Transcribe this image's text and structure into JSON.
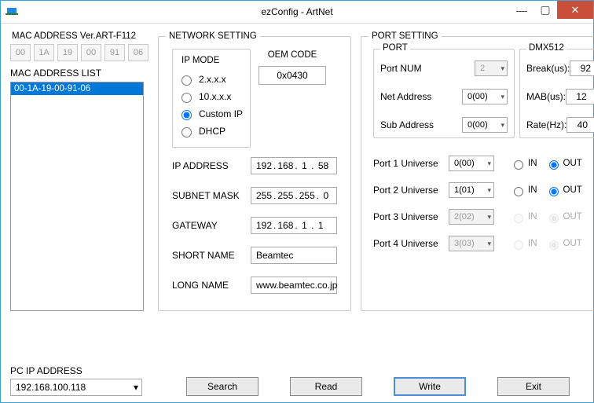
{
  "window": {
    "title": "ezConfig - ArtNet"
  },
  "mac": {
    "version_label": "MAC ADDRESS  Ver.ART-F112",
    "bytes": [
      "00",
      "1A",
      "19",
      "00",
      "91",
      "06"
    ],
    "list_label": "MAC ADDRESS LIST",
    "list": [
      "00-1A-19-00-91-06"
    ]
  },
  "network": {
    "legend": "NETWORK SETTING",
    "ipmode": {
      "label": "IP MODE",
      "options": {
        "opt2": "2.x.x.x",
        "opt10": "10.x.x.x",
        "custom": "Custom IP",
        "dhcp": "DHCP"
      },
      "selected": "custom"
    },
    "oem": {
      "label": "OEM CODE",
      "value": "0x0430"
    },
    "fields": {
      "ip": {
        "label": "IP ADDRESS",
        "a": "192",
        "b": "168",
        "c": "1",
        "d": "58"
      },
      "subnet": {
        "label": "SUBNET MASK",
        "a": "255",
        "b": "255",
        "c": "255",
        "d": "0"
      },
      "gateway": {
        "label": "GATEWAY",
        "a": "192",
        "b": "168",
        "c": "1",
        "d": "1"
      },
      "shortname": {
        "label": "SHORT NAME",
        "value": "Beamtec"
      },
      "longname": {
        "label": "LONG NAME",
        "value": "www.beamtec.co.jp"
      }
    }
  },
  "port": {
    "legend": "PORT SETTING",
    "port_group": {
      "label": "PORT",
      "port_num": {
        "label": "Port NUM",
        "value": "2"
      },
      "net_addr": {
        "label": "Net Address",
        "value": "0(00)"
      },
      "sub_addr": {
        "label": "Sub Address",
        "value": "0(00)"
      }
    },
    "dmx": {
      "label": "DMX512",
      "break": {
        "label": "Break(us):",
        "value": "92"
      },
      "mab": {
        "label": "MAB(us):",
        "value": "12"
      },
      "rate": {
        "label": "Rate(Hz):",
        "value": "40"
      }
    },
    "universes": [
      {
        "label": "Port 1 Universe",
        "value": "0(00)",
        "in": false,
        "out": true,
        "enabled": true
      },
      {
        "label": "Port 2 Universe",
        "value": "1(01)",
        "in": false,
        "out": true,
        "enabled": true
      },
      {
        "label": "Port 3 Universe",
        "value": "2(02)",
        "in": false,
        "out": true,
        "enabled": false
      },
      {
        "label": "Port 4 Universe",
        "value": "3(03)",
        "in": false,
        "out": true,
        "enabled": false
      }
    ],
    "io_labels": {
      "in": "IN",
      "out": "OUT"
    }
  },
  "bottom": {
    "pcip_label": "PC IP ADDRESS",
    "pcip_value": "192.168.100.118",
    "buttons": {
      "search": "Search",
      "read": "Read",
      "write": "Write",
      "exit": "Exit"
    }
  }
}
